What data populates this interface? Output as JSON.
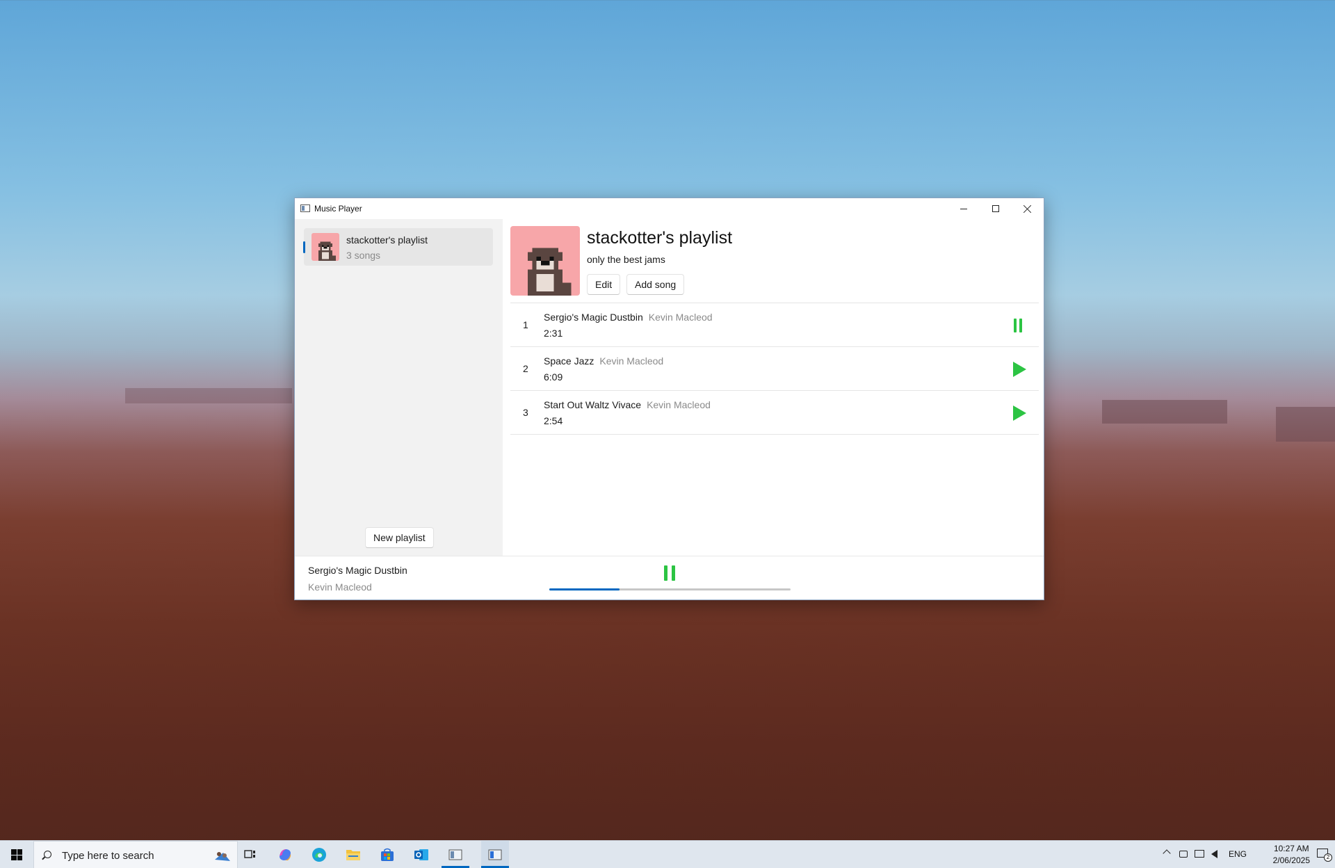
{
  "window": {
    "title": "Music Player"
  },
  "sidebar": {
    "playlists": [
      {
        "name": "stackotter's playlist",
        "count": "3 songs",
        "selected": true
      }
    ],
    "new_playlist_label": "New playlist"
  },
  "playlist": {
    "title": "stackotter's playlist",
    "description": "only the best jams",
    "edit_label": "Edit",
    "add_song_label": "Add song",
    "songs": [
      {
        "number": "1",
        "title": "Sergio's Magic Dustbin",
        "artist": "Kevin Macleod",
        "duration": "2:31",
        "state": "playing"
      },
      {
        "number": "2",
        "title": "Space Jazz",
        "artist": "Kevin Macleod",
        "duration": "6:09",
        "state": "stopped"
      },
      {
        "number": "3",
        "title": "Start Out Waltz Vivace",
        "artist": "Kevin Macleod",
        "duration": "2:54",
        "state": "stopped"
      }
    ]
  },
  "player": {
    "now_playing_title": "Sergio's Magic Dustbin",
    "now_playing_artist": "Kevin Macleod",
    "progress_fraction": 0.29
  },
  "taskbar": {
    "search_placeholder": "Type here to search",
    "language": "ENG",
    "time": "10:27 AM",
    "date": "2/06/2025",
    "notification_count": "2"
  },
  "colors": {
    "accent": "#0067c0",
    "play_green": "#2cc443",
    "cover_pink": "#f7a6a9"
  }
}
